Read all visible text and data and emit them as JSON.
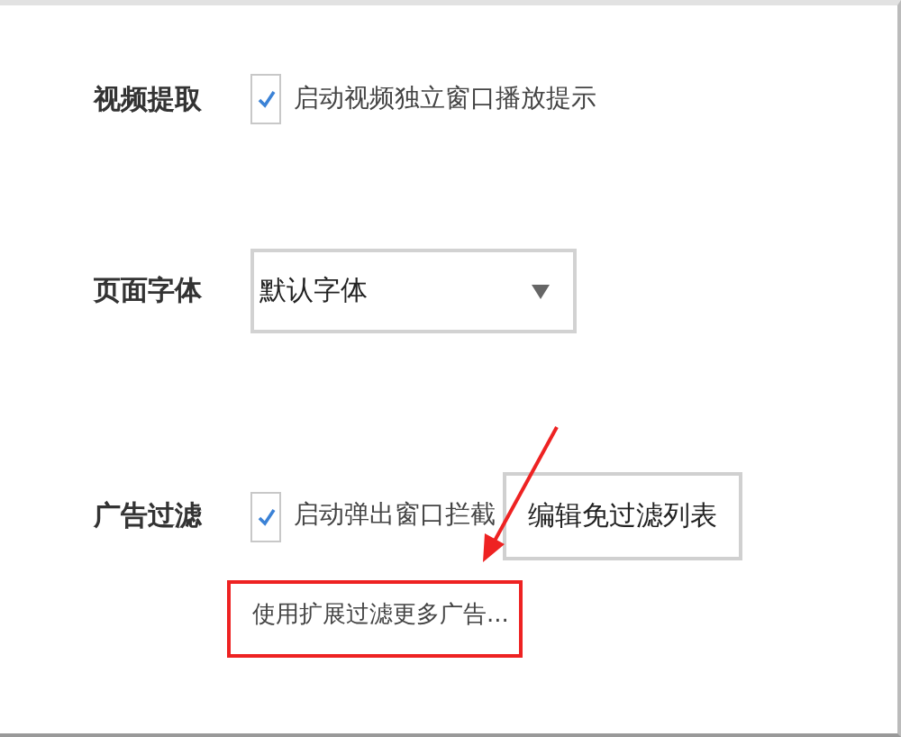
{
  "settings": [
    {
      "kind": "checkbox",
      "label": "视频提取",
      "checkbox": {
        "label": "启动视频独立窗口播放提示",
        "checked": true
      }
    },
    {
      "kind": "select",
      "label": "页面字体",
      "select": {
        "value": "默认字体"
      }
    },
    {
      "kind": "checkbox",
      "label": "广告过滤",
      "checkbox": {
        "label": "启动弹出窗口拦截",
        "checked": true
      },
      "button": "编辑免过滤列表",
      "link": "使用扩展过滤更多广告..."
    }
  ]
}
